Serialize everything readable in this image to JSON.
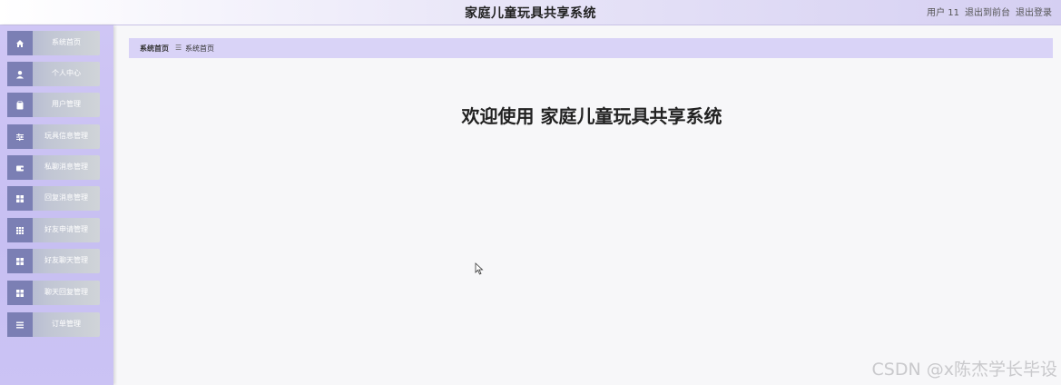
{
  "header": {
    "title": "家庭儿童玩具共享系统",
    "user_label": "用户 11",
    "goto_front_label": "退出到前台",
    "logout_label": "退出登录"
  },
  "sidebar": {
    "items": [
      {
        "label": "系统首页",
        "icon": "home-icon"
      },
      {
        "label": "个人中心",
        "icon": "user-icon"
      },
      {
        "label": "用户管理",
        "icon": "clipboard-icon"
      },
      {
        "label": "玩具信息管理",
        "icon": "sliders-icon"
      },
      {
        "label": "私聊消息管理",
        "icon": "wallet-icon"
      },
      {
        "label": "回复消息管理",
        "icon": "grid-icon"
      },
      {
        "label": "好友申请管理",
        "icon": "apps-icon"
      },
      {
        "label": "好友聊天管理",
        "icon": "grid-icon"
      },
      {
        "label": "聊天回复管理",
        "icon": "grid-icon"
      },
      {
        "label": "订单管理",
        "icon": "list-icon"
      }
    ]
  },
  "breadcrumb": {
    "home": "系统首页",
    "separator": "☰",
    "current": "系统首页"
  },
  "main": {
    "welcome": "欢迎使用 家庭儿童玩具共享系统"
  },
  "watermark": "CSDN @x陈杰学长毕设",
  "colors": {
    "sidebar_bg": "#cbc3f4",
    "menu_icon_bg": "#7b7fb4",
    "breadcrumb_bg": "#d9d3f7"
  }
}
